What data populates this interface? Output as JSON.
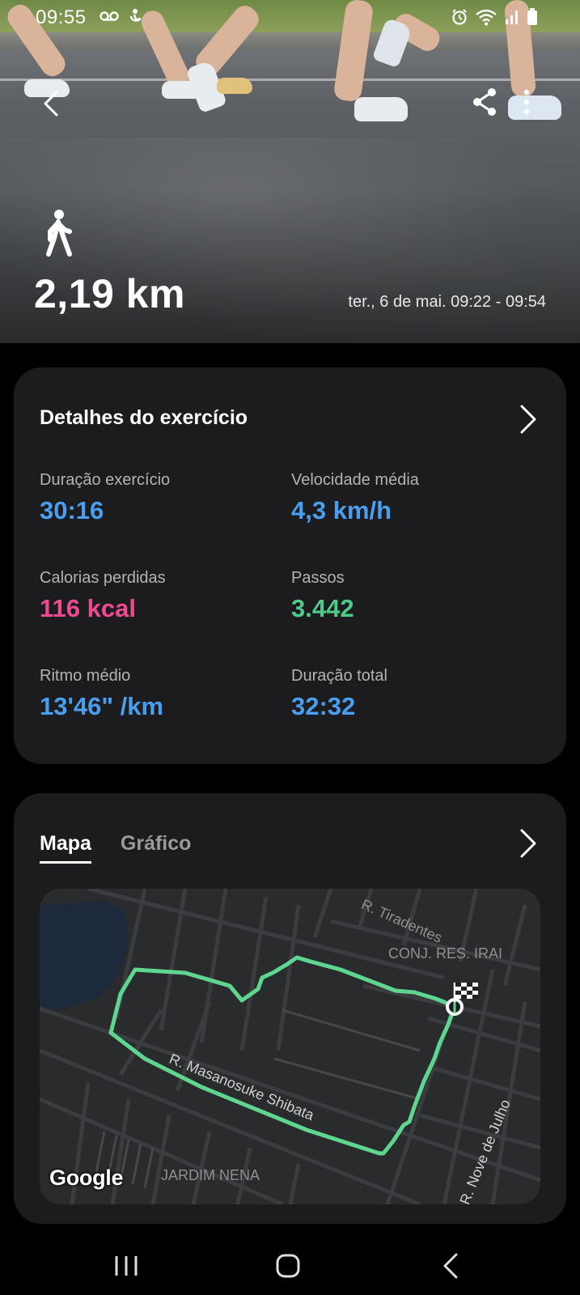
{
  "status_bar": {
    "time": "09:55",
    "left_icons": [
      "voicemail-icon",
      "accessibility-icon"
    ],
    "right_icons": [
      "alarm-icon",
      "wifi-icon",
      "signal-icon",
      "battery-icon"
    ]
  },
  "header": {
    "activity_icon": "walk-icon",
    "distance": "2,19 km",
    "session_time": "ter., 6 de mai. 09:22 - 09:54"
  },
  "details": {
    "title": "Detalhes do exercício",
    "stats": [
      {
        "label": "Duração exercício",
        "value": "30:16",
        "color": "#4a9ef0"
      },
      {
        "label": "Velocidade média",
        "value": "4,3 km/h",
        "color": "#4a9ef0"
      },
      {
        "label": "Calorias perdidas",
        "value": "116 kcal",
        "color": "#ec4c8d"
      },
      {
        "label": "Passos",
        "value": "3.442",
        "color": "#50c98a"
      },
      {
        "label": "Ritmo médio",
        "value": "13'46\" /km",
        "color": "#4a9ef0"
      },
      {
        "label": "Duração total",
        "value": "32:32",
        "color": "#4a9ef0"
      }
    ]
  },
  "map_card": {
    "tabs": [
      {
        "label": "Mapa",
        "active": true
      },
      {
        "label": "Gráfico",
        "active": false
      }
    ],
    "map": {
      "attribution": "Google",
      "labels": [
        "R. Tiradentes",
        "CONJ. RES. IRAI",
        "R. Masanosuke Shibata",
        "R. Nove de Julho",
        "JARDIM NENA"
      ],
      "route_color": "#5fd68f"
    }
  },
  "nav_bar": {
    "buttons": [
      "recent-apps-icon",
      "home-icon",
      "back-icon"
    ]
  }
}
